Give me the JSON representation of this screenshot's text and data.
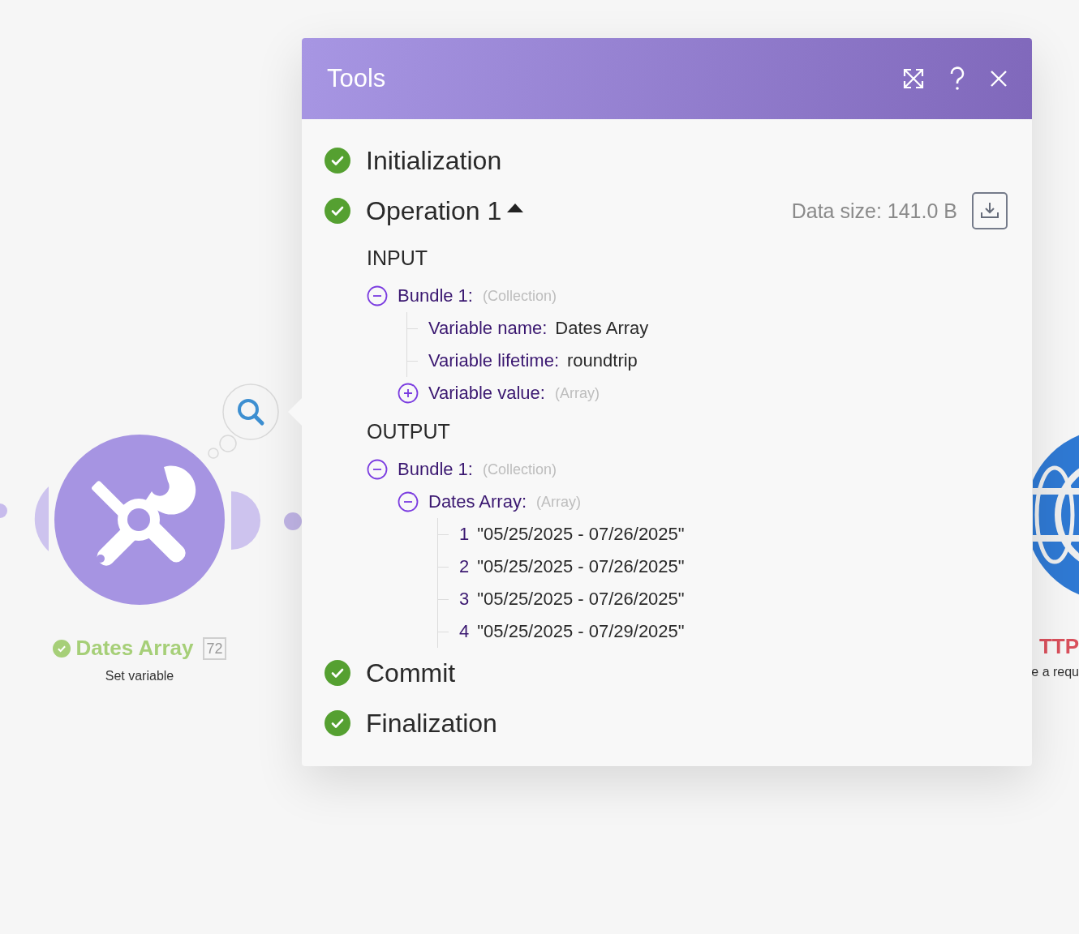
{
  "canvas": {
    "modules": [
      {
        "kind": "tools",
        "title": "Dates Array",
        "count": "72",
        "subtitle": "Set variable",
        "done": true
      },
      {
        "kind": "http",
        "title": "TTP",
        "subtitle": "e a requ"
      }
    ]
  },
  "panel": {
    "title": "Tools",
    "steps": [
      {
        "label": "Initialization",
        "done": true
      },
      {
        "label": "Operation 1",
        "done": true,
        "expanded": true,
        "data_size": "Data size: 141.0 B",
        "sections": [
          {
            "heading": "INPUT",
            "tree": [
              {
                "key": "Bundle 1:",
                "type": "(Collection)",
                "expanded": true,
                "children": [
                  {
                    "key": "Variable name:",
                    "value": "Dates Array"
                  },
                  {
                    "key": "Variable lifetime:",
                    "value": "roundtrip"
                  },
                  {
                    "key": "Variable value:",
                    "type": "(Array)",
                    "expanded": false
                  }
                ]
              }
            ]
          },
          {
            "heading": "OUTPUT",
            "tree": [
              {
                "key": "Bundle 1:",
                "type": "(Collection)",
                "expanded": true,
                "children": [
                  {
                    "key": "Dates Array:",
                    "type": "(Array)",
                    "expanded": true,
                    "children": [
                      {
                        "key": "1",
                        "value": "\"05/25/2025 - 07/26/2025\""
                      },
                      {
                        "key": "2",
                        "value": "\"05/25/2025 - 07/26/2025\""
                      },
                      {
                        "key": "3",
                        "value": "\"05/25/2025 - 07/26/2025\""
                      },
                      {
                        "key": "4",
                        "value": "\"05/25/2025 - 07/29/2025\""
                      }
                    ]
                  }
                ]
              }
            ]
          }
        ]
      },
      {
        "label": "Commit",
        "done": true
      },
      {
        "label": "Finalization",
        "done": true
      }
    ]
  }
}
